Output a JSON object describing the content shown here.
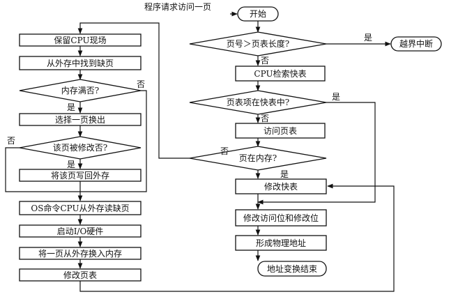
{
  "title": "程序请求访问一页",
  "start": "开始",
  "page_exceed_q": "页号＞页表长度?",
  "yes": "是",
  "no": "否",
  "overflow": "越界中断",
  "cpu_search_tlb": "CPU检索快表",
  "in_tlb_q": "页表项在快表中?",
  "visit_pt": "访问页表",
  "in_memory_q": "页在内存?",
  "modify_tlb": "修改快表",
  "modify_bits": "修改访问位和修改位",
  "form_addr": "形成物理地址",
  "end": "地址变换结束",
  "save_cpu": "保留CPU现场",
  "find_fault": "从外存中找到缺页",
  "mem_full_q": "内存满否?",
  "choose_swap": "选择一页换出",
  "modified_q": "该页被修改否?",
  "write_back": "将该页写回外存",
  "os_cmd": "OS命令CPU从外存读缺页",
  "start_io": "启动I/O硬件",
  "swap_in": "将一页从外存换入内存",
  "modify_pt": "修改页表"
}
